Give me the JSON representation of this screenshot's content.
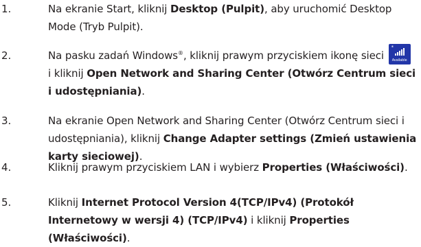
{
  "steps": [
    {
      "number": "1.",
      "parts": [
        {
          "t": "Na ekranie Start, kliknij "
        },
        {
          "t": "Desktop (Pulpit)",
          "b": true
        },
        {
          "t": ", aby uruchomić Desktop Mode (Tryb Pulpit)."
        }
      ]
    },
    {
      "number": "2.",
      "parts": [
        {
          "t": "Na pasku zadań Windows"
        },
        {
          "t": "®",
          "sup": true
        },
        {
          "t": ", kliknij prawym przyciskiem ikonę sieci "
        },
        {
          "icon": "network-icon"
        },
        {
          "t": " i kliknij "
        },
        {
          "t": "Open Network and Sharing Center (Otwórz Centrum sieci i udostępniania)",
          "b": true
        },
        {
          "t": "."
        }
      ]
    },
    {
      "number": "3.",
      "parts": [
        {
          "t": "Na ekranie Open Network and Sharing Center (Otwórz Centrum sieci i udostępniania), kliknij "
        },
        {
          "t": "Change Adapter settings (Zmień ustawienia karty sieciowej)",
          "b": true
        },
        {
          "t": "."
        }
      ]
    },
    {
      "number": "4.",
      "parts": [
        {
          "t": "Kliknij prawym przyciskiem LAN i wybierz "
        },
        {
          "t": "Properties (Właściwości)",
          "b": true
        },
        {
          "t": "."
        }
      ]
    },
    {
      "number": "5.",
      "parts": [
        {
          "t": "Kliknij "
        },
        {
          "t": "Internet Protocol Version 4(TCP/IPv4) (Protokół Internetowy w wersji 4) (TCP/IPv4)",
          "b": true
        },
        {
          "t": " i kliknij "
        },
        {
          "t": "Properties (Właściwości)",
          "b": true
        },
        {
          "t": "."
        }
      ]
    }
  ],
  "network_icon": {
    "label": "Available",
    "star": "*",
    "icon": "wifi-signal-icon",
    "color": "#2236a8"
  }
}
